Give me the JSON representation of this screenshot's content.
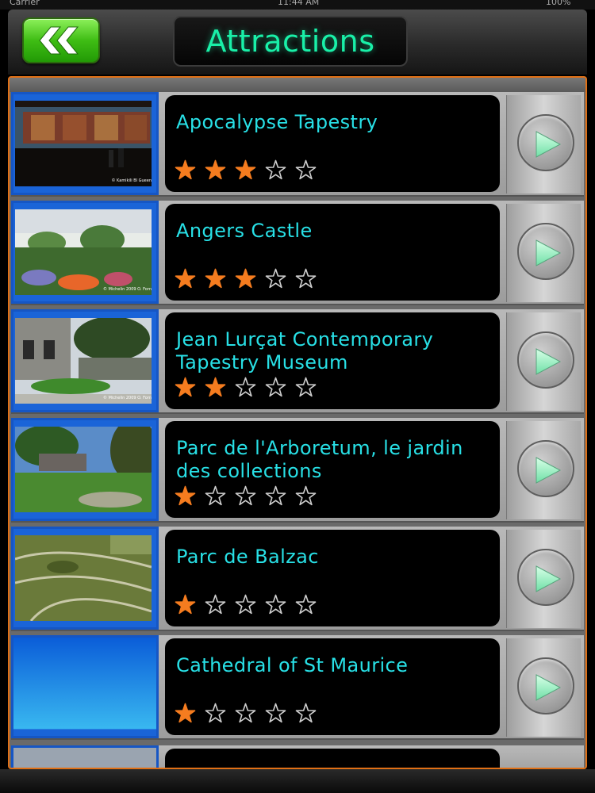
{
  "status": {
    "carrier": "Carrier",
    "time": "11:44 AM",
    "battery": "100%"
  },
  "nav": {
    "back_icon": "double-chevron-left-icon",
    "title": "Attractions"
  },
  "colors": {
    "accent": "#19f0a8",
    "name_text": "#28e0e6",
    "star_on": "#f57c1f",
    "frame": "#e07016"
  },
  "attractions": [
    {
      "name": "Apocalypse Tapestry",
      "rating": 3,
      "credit": "© Kamikili\nBl Gueen"
    },
    {
      "name": "Angers Castle",
      "rating": 3,
      "credit": "© Michelin 2009\nO. Forn"
    },
    {
      "name": "Jean Lurçat Contemporary Tapestry Museum",
      "rating": 2,
      "credit": "© Michelin 2009\nO. Forn"
    },
    {
      "name": "Parc de l'Arboretum, le jardin des collections",
      "rating": 1,
      "credit": ""
    },
    {
      "name": "Parc de Balzac",
      "rating": 1,
      "credit": ""
    },
    {
      "name": "Cathedral of St Maurice",
      "rating": 1,
      "credit": ""
    }
  ],
  "max_rating": 5
}
